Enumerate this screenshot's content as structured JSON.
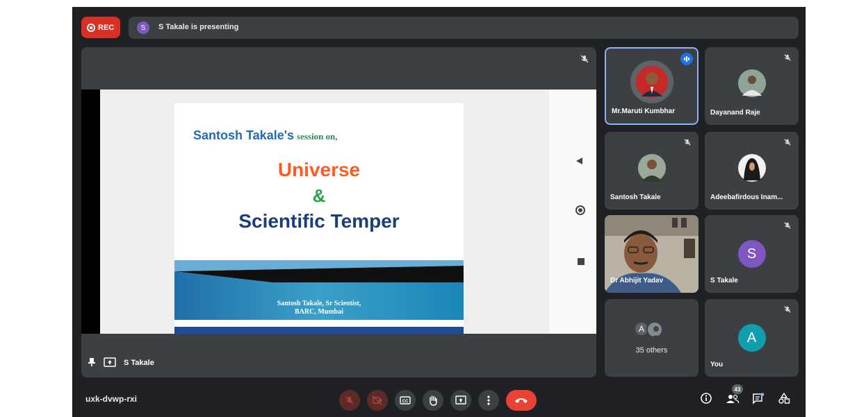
{
  "recording": {
    "label": "REC"
  },
  "presenting": {
    "avatar_letter": "S",
    "text": "S Takale is presenting"
  },
  "main": {
    "presenter_name": "S Takale",
    "slide": {
      "name_line": "Santosh Takale's",
      "session_line": "session on,",
      "title_line1": "Universe",
      "title_line2": "&",
      "title_line3": "Scientific Temper",
      "footer_line1": "Santosh Takale, Sr Scientist,",
      "footer_line2": "BARC, Mumbai"
    }
  },
  "participants": [
    {
      "name": "Mr.Maruti Kumbhar",
      "speaking": true
    },
    {
      "name": "Dayanand Raje",
      "muted": true
    },
    {
      "name": "Santosh Takale",
      "muted": true
    },
    {
      "name": "Adeebafirdous Inam...",
      "muted": true
    },
    {
      "name": "Dr Abhijit Yadav",
      "video": true
    },
    {
      "name": "S Takale",
      "muted": true,
      "avatar_letter": "S",
      "avatar_color": "#7e57c2"
    },
    {
      "name": "35 others",
      "avatar_letter": "A",
      "avatar_color": "#5f6368"
    },
    {
      "name": "You",
      "muted": true,
      "avatar_letter": "A",
      "avatar_color": "#129eaf"
    }
  ],
  "bottom_bar": {
    "meeting_code": "uxk-dvwp-rxi",
    "participant_count": "43",
    "icons": [
      "mic-off-icon",
      "camera-off-icon",
      "captions-icon",
      "raise-hand-icon",
      "present-icon",
      "more-icon",
      "end-call-icon",
      "info-icon",
      "people-icon",
      "chat-icon",
      "activities-icon"
    ]
  },
  "colors": {
    "rec": "#d93025",
    "end_call": "#ea4335",
    "active_border": "#8ab4f8",
    "background": "#202124",
    "tile": "#3c4043"
  }
}
